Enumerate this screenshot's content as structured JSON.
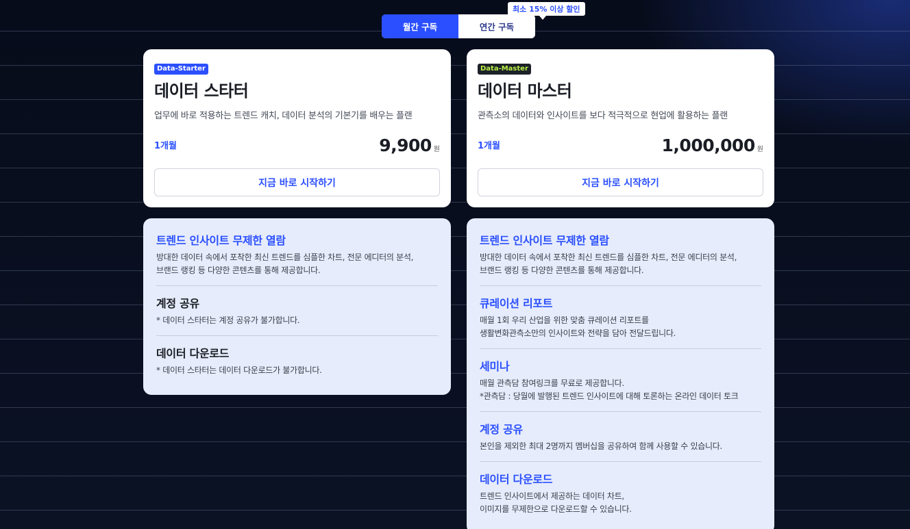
{
  "toggle": {
    "monthly_label": "월간 구독",
    "yearly_label": "연간 구독",
    "discount_badge": "최소 15% 이상 할인"
  },
  "plans": [
    {
      "tag": "Data-Starter",
      "name": "데이터 스타터",
      "description": "업무에 바로 적용하는 트렌드 캐치, 데이터 분석의 기본기를 배우는 플랜",
      "period": "1개월",
      "price": "9,900",
      "currency": "원",
      "cta": "지금 바로 시작하기",
      "features": [
        {
          "title": "트렌드 인사이트 무제한 열람",
          "lines": [
            "방대한 데이터 속에서 포착한 최신 트렌드를 심플한 차트, 전문 에디터의 분석,",
            "브랜드 랭킹 등 다양한 콘텐츠를 통해 제공합니다."
          ]
        },
        {
          "title": "계정 공유",
          "lines": [
            "* 데이터 스타터는 계정 공유가 불가합니다."
          ]
        },
        {
          "title": "데이터 다운로드",
          "lines": [
            "* 데이터 스타터는 데이터 다운로드가 불가합니다."
          ]
        }
      ]
    },
    {
      "tag": "Data-Master",
      "name": "데이터 마스터",
      "description": "관측소의 데이터와 인사이트를 보다 적극적으로 현업에 활용하는 플랜",
      "period": "1개월",
      "price": "1,000,000",
      "currency": "원",
      "cta": "지금 바로 시작하기",
      "features": [
        {
          "title": "트렌드 인사이트 무제한 열람",
          "lines": [
            "방대한 데이터 속에서 포착한 최신 트렌드를 심플한 차트, 전문 에디터의 분석,",
            "브랜드 랭킹 등 다양한 콘텐츠를 통해 제공합니다."
          ]
        },
        {
          "title": "큐레이션 리포트",
          "lines": [
            "매월 1회 우리 산업을 위한 맞춤 큐레이션 리포트를",
            "생활변화관측소만의 인사이트와 전략을 담아 전달드립니다."
          ]
        },
        {
          "title": "세미나",
          "lines": [
            "매월 관측담 참여링크를 무료로 제공합니다.",
            "*관측담 : 당월에 발행된 트렌드 인사이트에 대해 토론하는 온라인 데이터 토크"
          ]
        },
        {
          "title": "계정 공유",
          "lines": [
            "본인을 제외한 최대 2명까지 멤버십을 공유하여 함께 사용할 수 있습니다."
          ]
        },
        {
          "title": "데이터 다운로드",
          "lines": [
            "트렌드 인사이트에서 제공하는 데이터 차트,",
            "이미지를 무제한으로 다운로드할 수 있습니다."
          ]
        }
      ]
    }
  ],
  "colors": {
    "accent": "#2b4fff",
    "master_tag_text": "#b7f046",
    "feature_bg": "#e6ecfb"
  }
}
